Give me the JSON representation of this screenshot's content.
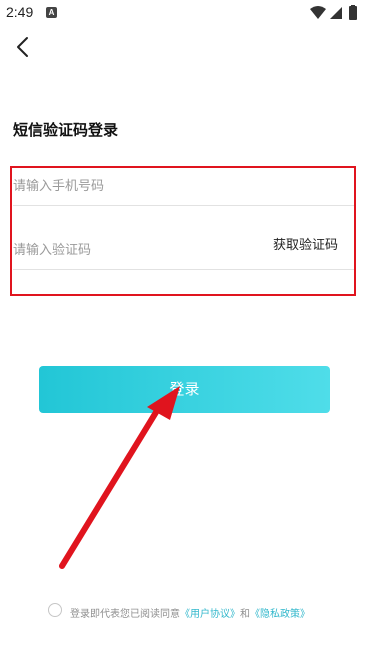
{
  "status_bar": {
    "time": "2:49",
    "notification_icon": "a-icon"
  },
  "header": {
    "back_icon": "chevron-left-icon"
  },
  "page": {
    "title": "短信验证码登录"
  },
  "form": {
    "phone_placeholder": "请输入手机号码",
    "code_placeholder": "请输入验证码",
    "get_code_label": "获取验证码",
    "login_label": "登录"
  },
  "agreement": {
    "prefix": "登录即代表您已阅读同意",
    "user_agreement": "《用户协议》",
    "and": "和",
    "privacy_policy": "《隐私政策》"
  },
  "colors": {
    "accent": "#22c6d6",
    "highlight_frame": "#e0141e",
    "arrow": "#e0141e"
  }
}
